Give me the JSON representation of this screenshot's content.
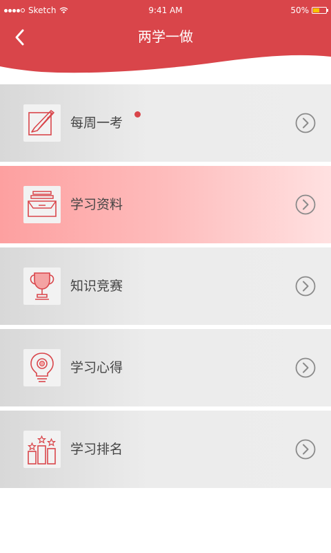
{
  "status_bar": {
    "carrier": "Sketch",
    "time": "9:41 AM",
    "battery": "50%",
    "battery_level": 0.5
  },
  "nav": {
    "title": "两学一做",
    "back_icon": "back-arrow-icon"
  },
  "colors": {
    "header": "#d9454a",
    "accent": "#d9454a",
    "active_row_start": "#fda0a0",
    "active_row_end": "#ffe1e1",
    "row_bg": "#ececec",
    "label": "#444444"
  },
  "menu": {
    "items": [
      {
        "label": "每周一考",
        "icon": "pen-paper-icon",
        "has_badge": true,
        "active": false
      },
      {
        "label": "学习资料",
        "icon": "file-tray-icon",
        "has_badge": false,
        "active": true
      },
      {
        "label": "知识竞赛",
        "icon": "trophy-icon",
        "has_badge": false,
        "active": false
      },
      {
        "label": "学习心得",
        "icon": "lightbulb-icon",
        "has_badge": false,
        "active": false
      },
      {
        "label": "学习排名",
        "icon": "podium-icon",
        "has_badge": false,
        "active": false
      }
    ]
  }
}
